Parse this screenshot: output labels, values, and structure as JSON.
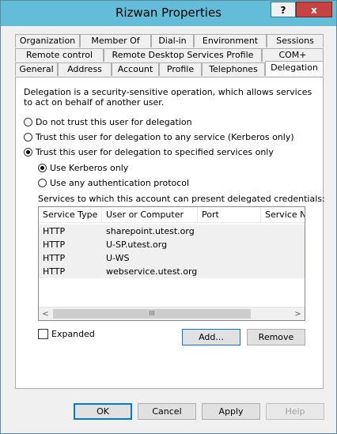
{
  "window": {
    "title": "Rizwan Properties",
    "help_label": "?",
    "close_label": "x"
  },
  "tabs": {
    "row1": [
      "Organization",
      "Member Of",
      "Dial-in",
      "Environment",
      "Sessions"
    ],
    "row2": [
      "Remote control",
      "Remote Desktop Services Profile",
      "COM+"
    ],
    "row3": [
      "General",
      "Address",
      "Account",
      "Profile",
      "Telephones",
      "Delegation"
    ],
    "active": "Delegation"
  },
  "delegation": {
    "description": "Delegation is a security-sensitive operation, which allows services to act on behalf of another user.",
    "options": [
      "Do not trust this user for delegation",
      "Trust this user for delegation to any service (Kerberos only)",
      "Trust this user for delegation to specified services only"
    ],
    "selected_option": 2,
    "sub_options": [
      "Use Kerberos only",
      "Use any authentication protocol"
    ],
    "selected_sub_option": 0,
    "services_label": "Services to which this account can present delegated credentials:",
    "columns": [
      "Service Type",
      "User or Computer",
      "Port",
      "Service Na"
    ],
    "rows": [
      {
        "type": "HTTP",
        "host": "sharepoint.utest.org",
        "port": "",
        "service": ""
      },
      {
        "type": "HTTP",
        "host": "U-SP.utest.org",
        "port": "",
        "service": ""
      },
      {
        "type": "HTTP",
        "host": "U-WS",
        "port": "",
        "service": ""
      },
      {
        "type": "HTTP",
        "host": "webservice.utest.org",
        "port": "",
        "service": ""
      }
    ],
    "expanded_label": "Expanded",
    "expanded_checked": false,
    "add_label": "Add...",
    "remove_label": "Remove"
  },
  "footer": {
    "ok": "OK",
    "cancel": "Cancel",
    "apply": "Apply",
    "help": "Help"
  },
  "icons": {
    "scroll_left": "<",
    "scroll_right": ">",
    "scroll_thumb": "III"
  },
  "colors": {
    "titlebar": "#63bdd9",
    "close": "#c74343",
    "row_bg": "#f0f0f0"
  }
}
